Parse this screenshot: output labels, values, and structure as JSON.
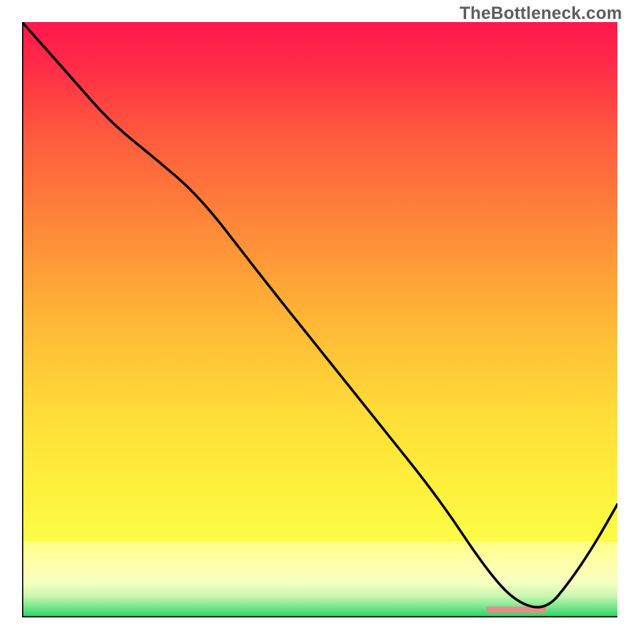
{
  "watermark": {
    "text": "TheBottleneck.com"
  },
  "chart_data": {
    "type": "line",
    "title": "",
    "xlabel": "",
    "ylabel": "",
    "xlim": [
      0,
      100
    ],
    "ylim": [
      0,
      100
    ],
    "grid": false,
    "legend": false,
    "background": {
      "top_color": "#ff1a4b",
      "upper_mid_color": "#ffa237",
      "lower_mid_color": "#ffe73a",
      "pale_band_color": "#ffff9e",
      "bottom_color": "#22dd66"
    },
    "marker_segment": {
      "x_start": 78,
      "x_end": 88,
      "y": 1.3,
      "color": "#e88b8b"
    },
    "series": [
      {
        "name": "curve",
        "color": "#000000",
        "x": [
          0,
          8,
          15,
          22.5,
          30,
          40,
          50,
          60,
          70,
          78,
          83,
          88,
          92,
          96,
          100
        ],
        "y": [
          100,
          91,
          83,
          77,
          70.5,
          57.5,
          45,
          32.5,
          20,
          8,
          2.5,
          1.2,
          6,
          12,
          19
        ]
      }
    ]
  }
}
